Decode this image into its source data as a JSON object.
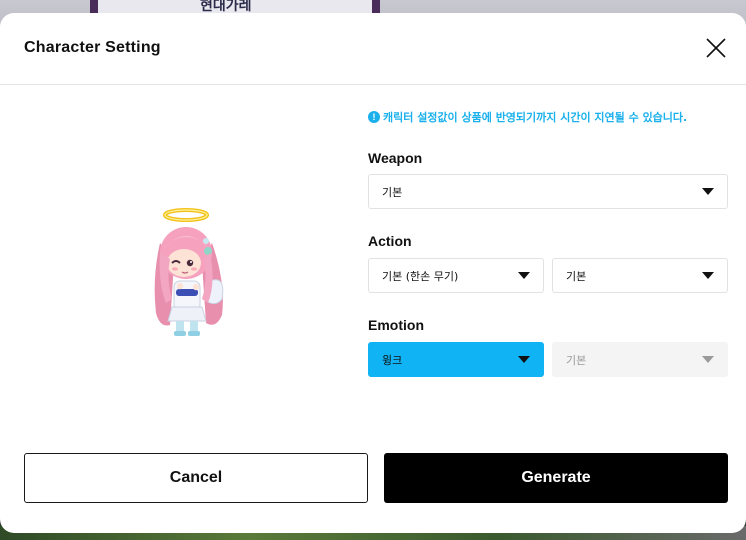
{
  "background": {
    "panel_text": "현대가레"
  },
  "modal": {
    "title": "Character Setting",
    "notice": "캐릭터 설정값이 상품에 반영되기까지 시간이 지연될 수 있습니다.",
    "notice_icon": "!",
    "weapon": {
      "label": "Weapon",
      "selected": "기본"
    },
    "action": {
      "label": "Action",
      "primary_selected": "기본 (한손 무기)",
      "secondary_selected": "기본"
    },
    "emotion": {
      "label": "Emotion",
      "primary_selected": "윙크",
      "secondary_selected": "기본"
    },
    "buttons": {
      "cancel": "Cancel",
      "generate": "Generate"
    }
  },
  "colors": {
    "accent": "#10b3f3",
    "notice": "#1ab0ec",
    "primary_button": "#000000"
  },
  "icons": {
    "close": "close-icon",
    "notice": "info-circle-icon",
    "dropdown": "caret-down-icon"
  }
}
